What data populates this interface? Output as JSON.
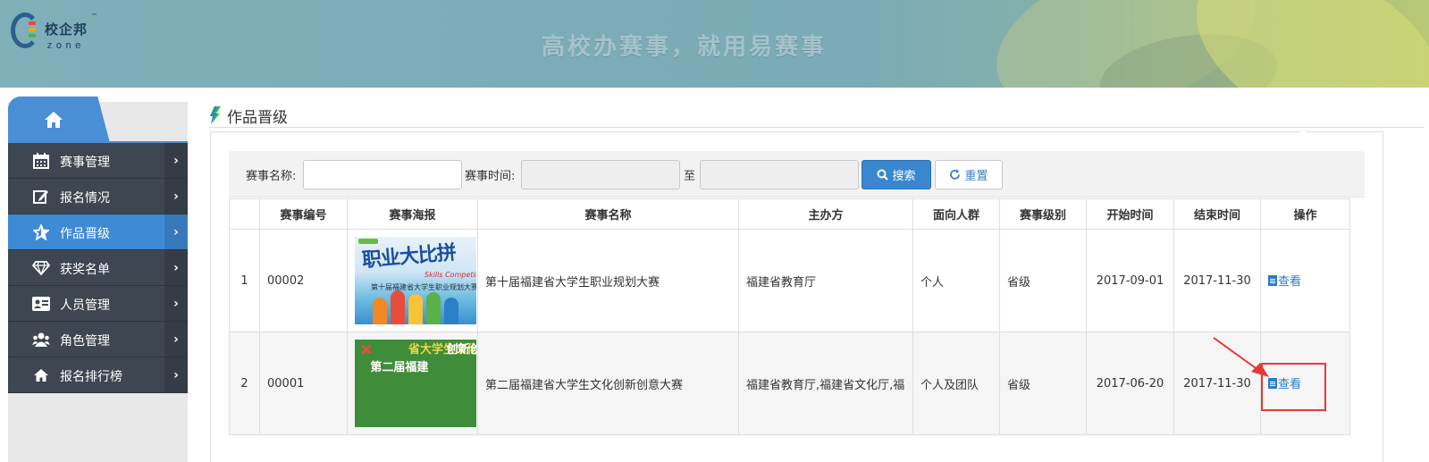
{
  "header": {
    "logo_cn": "校企邦",
    "logo_en": "zone",
    "logo_tm": "™",
    "slogan": "高校办赛事，就用易赛事"
  },
  "sidebar": {
    "items": [
      {
        "label": "赛事管理",
        "icon": "calendar-icon",
        "active": false
      },
      {
        "label": "报名情况",
        "icon": "edit-icon",
        "active": false
      },
      {
        "label": "作品晋级",
        "icon": "star-icon",
        "active": true
      },
      {
        "label": "获奖名单",
        "icon": "diamond-icon",
        "active": false
      },
      {
        "label": "人员管理",
        "icon": "id-card-icon",
        "active": false
      },
      {
        "label": "角色管理",
        "icon": "users-icon",
        "active": false
      },
      {
        "label": "报名排行榜",
        "icon": "home-icon",
        "active": false
      }
    ],
    "arrow": "›"
  },
  "main": {
    "title": "作品晋级"
  },
  "search": {
    "name_label": "赛事名称:",
    "name_value": "",
    "time_label": "赛事时间:",
    "to_label": "至",
    "start_value": "",
    "end_value": "",
    "search_button": "搜索",
    "reset_button": "重置"
  },
  "table": {
    "headers": [
      "",
      "赛事编号",
      "赛事海报",
      "赛事名称",
      "主办方",
      "面向人群",
      "赛事级别",
      "开始时间",
      "结束时间",
      "操作"
    ],
    "rows": [
      {
        "index": "1",
        "code": "00002",
        "name": "第十届福建省大学生职业规划大赛",
        "organizer": "福建省教育厅",
        "audience": "个人",
        "level": "省级",
        "start": "2017-09-01",
        "end": "2017-11-30",
        "action": "查看",
        "poster": {
          "title": "职业大比拼",
          "subtitle": "第十届福建省大学生职业规划大赛",
          "english": "Skills Competition"
        }
      },
      {
        "index": "2",
        "code": "00001",
        "name": "第二届福建省大学生文化创新创意大赛",
        "organizer": "福建省教育厅,福建省文化厅,福",
        "audience": "个人及团队",
        "level": "省级",
        "start": "2017-06-20",
        "end": "2017-11-30",
        "action": "查看",
        "poster": {
          "columns": [
            "第二届福建",
            "省大学生文化",
            "创新创意大赛"
          ]
        }
      }
    ]
  },
  "colors": {
    "accent": "#3a87d0",
    "sidebar_bg": "#3d4651",
    "sidebar_active": "#3e8ad5",
    "annotation": "#e53935"
  }
}
